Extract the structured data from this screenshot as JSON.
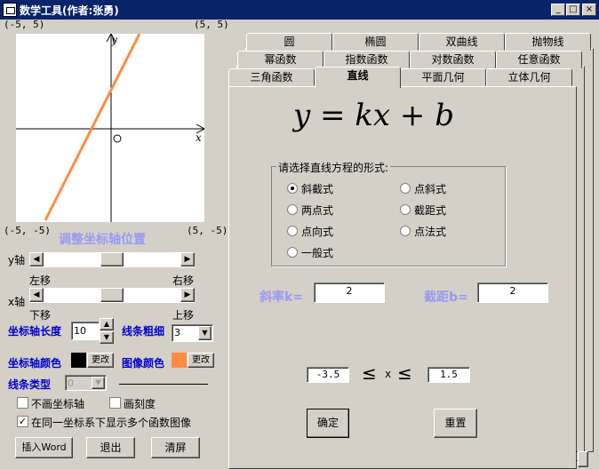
{
  "window": {
    "title": "数学工具(作者:张勇)",
    "min": "_",
    "max": "□",
    "close": "×"
  },
  "graph": {
    "corner_tl": "(-5, 5)",
    "corner_tr": "(5, 5)",
    "corner_bl": "(-5, -5)",
    "corner_br": "(5, -5)",
    "y_label": "y",
    "x_label": "x",
    "origin_label": "O"
  },
  "left": {
    "adjust_axis_title": "调整坐标轴位置",
    "y_axis_label": "y轴",
    "x_axis_label": "x轴",
    "left_move": "左移",
    "right_move": "右移",
    "down_move": "下移",
    "up_move": "上移",
    "axis_length_label": "坐标轴长度",
    "axis_length_value": "10",
    "line_thickness_label": "线条粗细",
    "line_thickness_value": "3",
    "axis_color_label": "坐标轴颜色",
    "axis_color": "#000000",
    "image_color_label": "图像颜色",
    "image_color": "#ff8c40",
    "change_button": "更改",
    "line_type_label": "线条类型",
    "line_type_value": "0",
    "no_axis": "不画坐标轴",
    "draw_scale": "画刻度",
    "multi_graph": "在同一坐标系下显示多个函数图像",
    "insert_word": "插入Word",
    "exit": "退出",
    "clear": "清屏"
  },
  "tabs": {
    "row1": [
      "圆",
      "椭圆",
      "双曲线",
      "抛物线"
    ],
    "row2": [
      "幂函数",
      "指数函数",
      "对数函数",
      "任意函数"
    ],
    "row3": [
      "三角函数",
      "直线",
      "平面几何",
      "立体几何"
    ],
    "active": "直线"
  },
  "panel": {
    "formula": "y = kx + b",
    "group_title": "请选择直线方程的形式:",
    "options": [
      "斜截式",
      "点斜式",
      "两点式",
      "截距式",
      "点向式",
      "点法式",
      "一般式"
    ],
    "selected": "斜截式",
    "slope_label": "斜率k=",
    "slope_value": "2",
    "intercept_label": "截距b=",
    "intercept_value": "2",
    "x_min": "-3.5",
    "x_max": "1.5",
    "less_sign": "≤",
    "x_var": "x",
    "confirm": "确定",
    "reset": "重置"
  }
}
